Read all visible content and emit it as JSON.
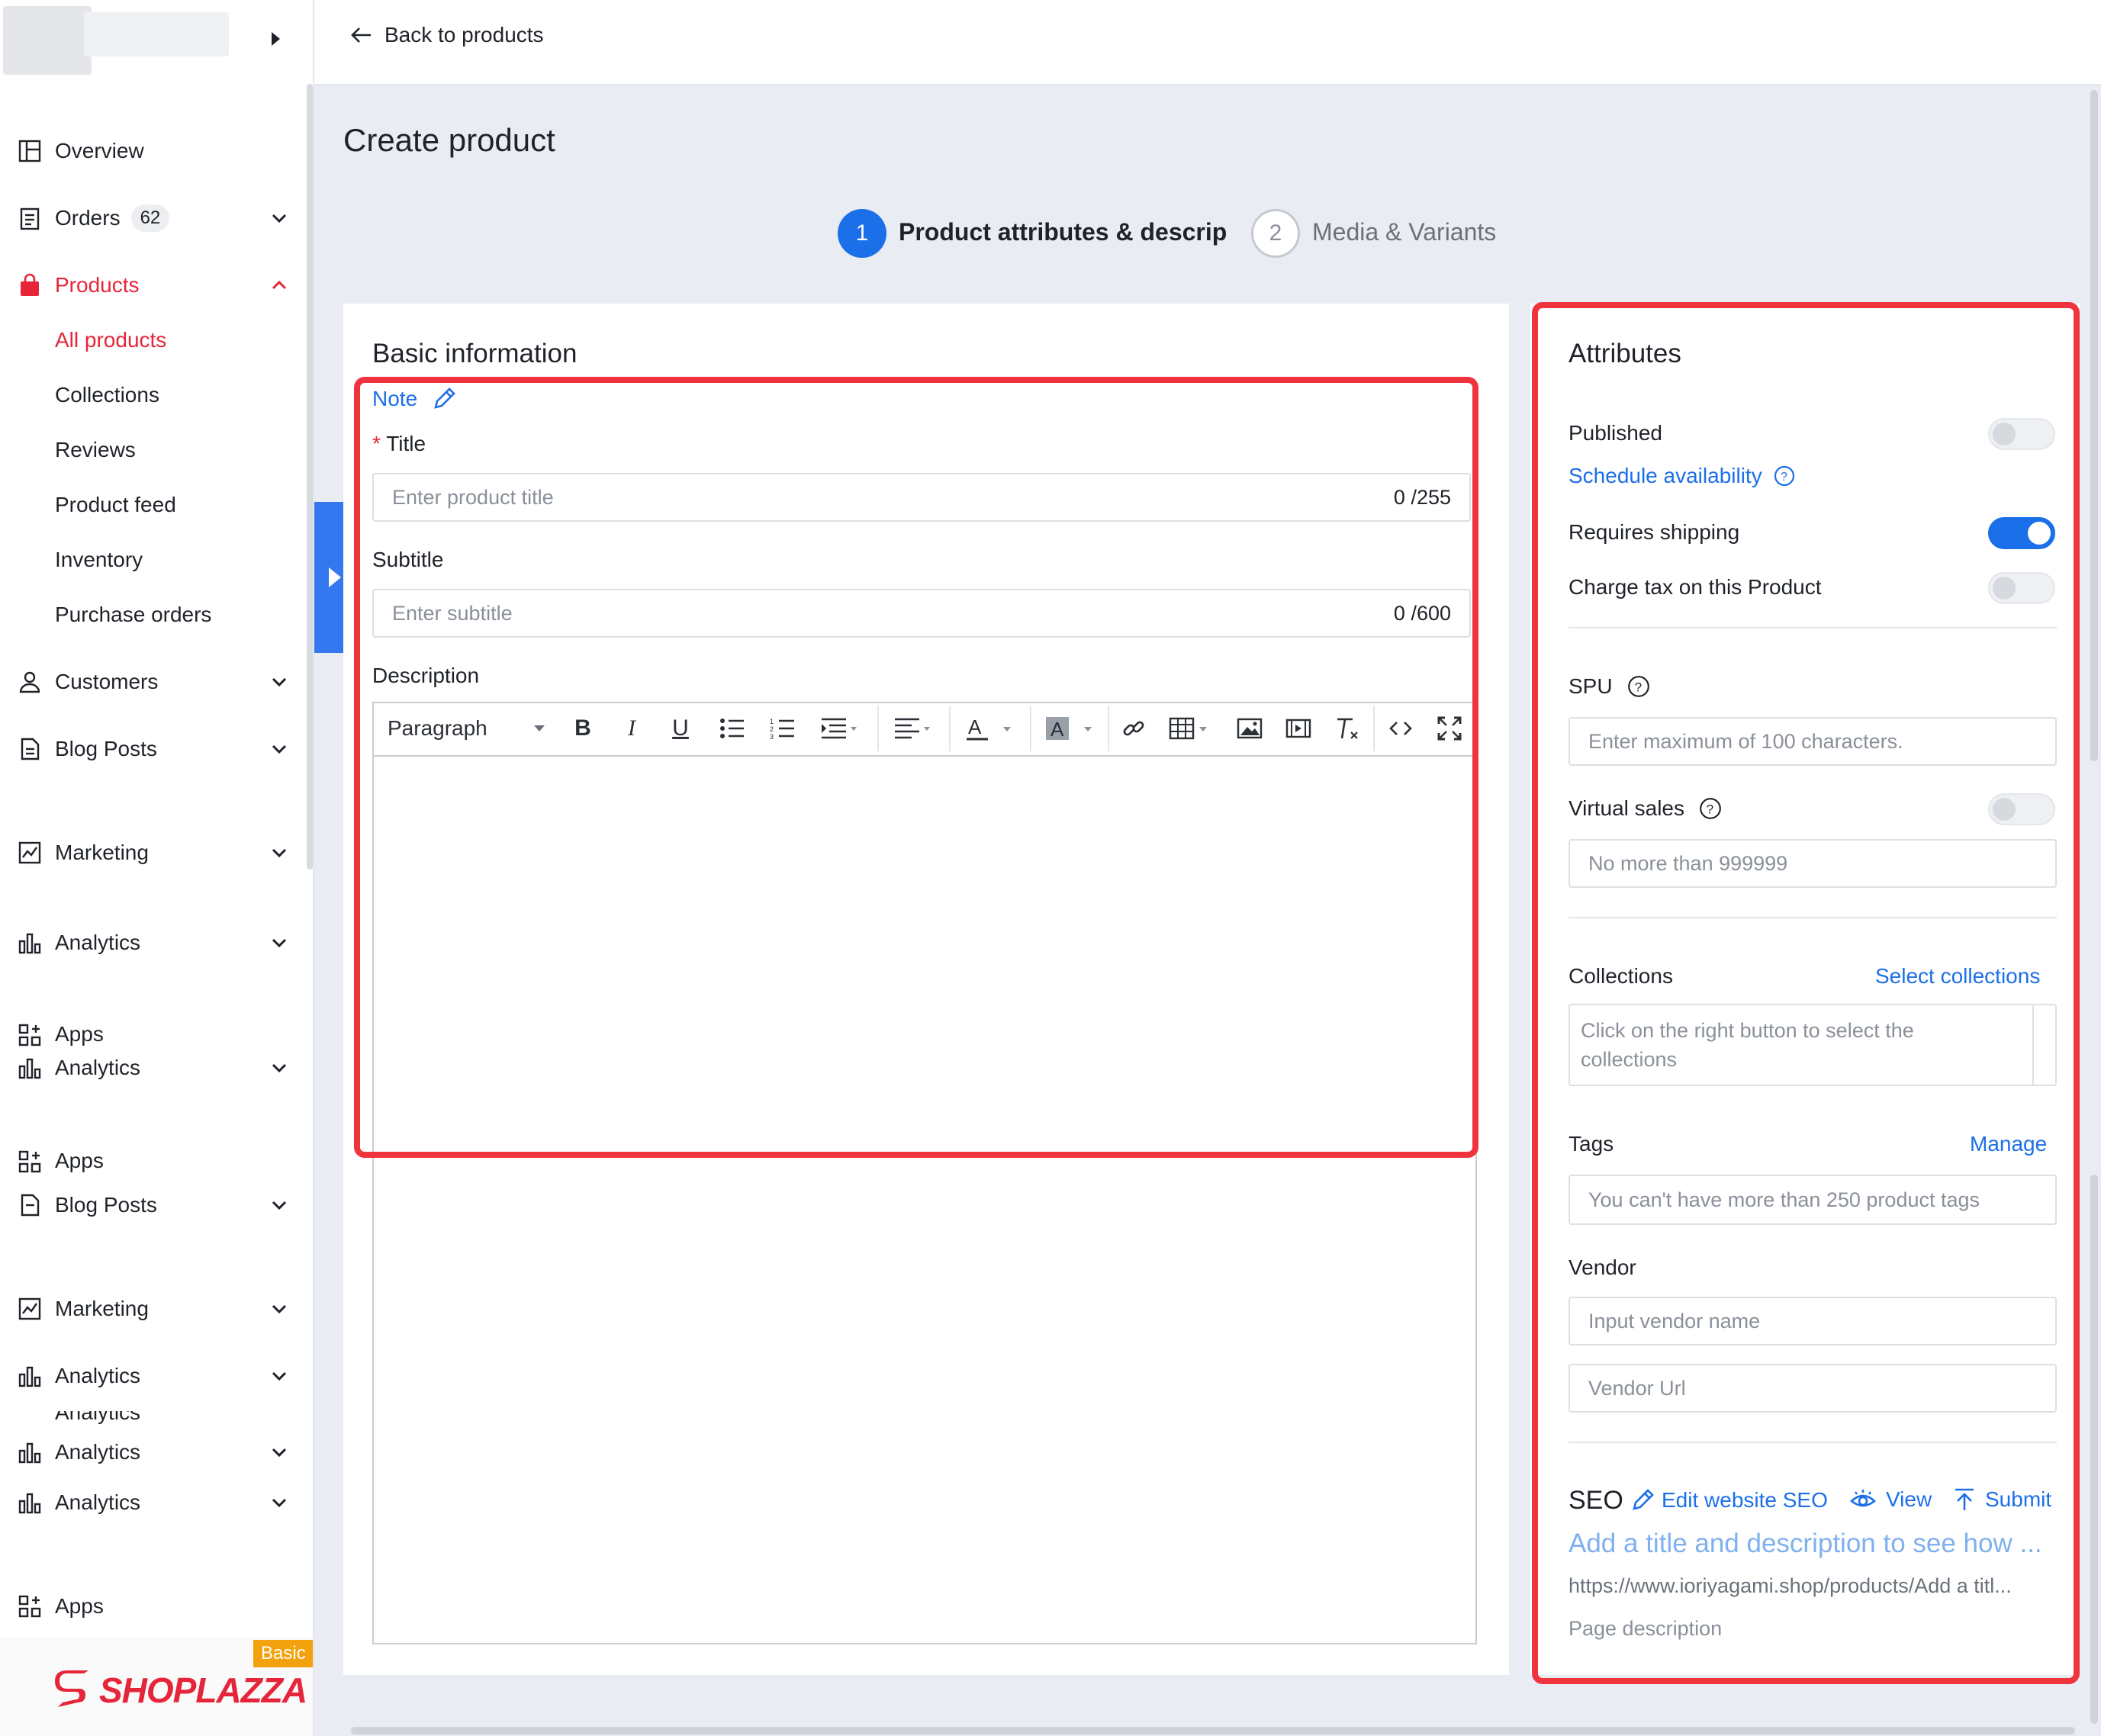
{
  "sidebar": {
    "orders_badge": "62",
    "items": [
      {
        "label": "Overview",
        "icon": "overview-icon"
      },
      {
        "label": "Orders",
        "icon": "orders-icon"
      },
      {
        "label": "Products",
        "icon": "products-icon"
      },
      {
        "label": "Customers",
        "icon": "customers-icon"
      },
      {
        "label": "Blog Posts",
        "icon": "blog-posts-icon"
      },
      {
        "label": "Marketing",
        "icon": "marketing-icon"
      },
      {
        "label": "Analytics",
        "icon": "analytics-icon"
      },
      {
        "label": "Apps",
        "icon": "apps-icon"
      }
    ],
    "sub_items": [
      "All products",
      "Collections",
      "Reviews",
      "Product feed",
      "Inventory",
      "Purchase orders"
    ],
    "glitch_items": [
      "Analytics",
      "Apps",
      "Blog Posts",
      "Marketing",
      "Analytics",
      "Analytics",
      "Analytics",
      "Analytics",
      "Apps"
    ],
    "plan_badge": "Basic",
    "logo_text": "SHOPLAZZA",
    "accent_color": "#e6253a"
  },
  "header": {
    "back_label": "Back to products",
    "page_title": "Create product"
  },
  "steps": [
    {
      "number": "1",
      "label": "Product attributes & descript"
    },
    {
      "number": "2",
      "label": "Media & Variants"
    }
  ],
  "basic": {
    "heading": "Basic information",
    "note_label": "Note",
    "title_label": "Title",
    "required_mark": "*",
    "title_placeholder": "Enter product title",
    "title_count": "0 /255",
    "subtitle_label": "Subtitle",
    "subtitle_placeholder": "Enter subtitle",
    "subtitle_count": "0 /600",
    "description_label": "Description",
    "paragraph_select": "Paragraph"
  },
  "attributes": {
    "heading": "Attributes",
    "published_label": "Published",
    "published_on": false,
    "schedule_link": "Schedule availability",
    "requires_shipping_label": "Requires shipping",
    "requires_shipping_on": true,
    "charge_tax_label": "Charge tax on this Product",
    "charge_tax_on": false,
    "spu_label": "SPU",
    "spu_placeholder": "Enter maximum of 100 characters.",
    "virtual_sales_label": "Virtual sales",
    "virtual_sales_on": false,
    "virtual_sales_placeholder": "No more than 999999",
    "collections_label": "Collections",
    "select_collections_link": "Select collections",
    "collections_placeholder": "Click on the right button to select the collections",
    "tags_label": "Tags",
    "manage_link": "Manage",
    "tags_placeholder": "You can't have more than 250 product tags",
    "vendor_label": "Vendor",
    "vendor_name_placeholder": "Input vendor name",
    "vendor_url_placeholder": "Vendor Url",
    "seo_label": "SEO",
    "edit_seo_link": "Edit website SEO",
    "view_link": "View",
    "submit_link": "Submit",
    "seo_preview_title": "Add a title and description to see how ...",
    "seo_preview_url": "https://www.ioriyagami.shop/products/Add a titl...",
    "seo_preview_desc": "Page description"
  },
  "colors": {
    "primary": "#1b6fe8",
    "highlight": "#f0343e"
  }
}
